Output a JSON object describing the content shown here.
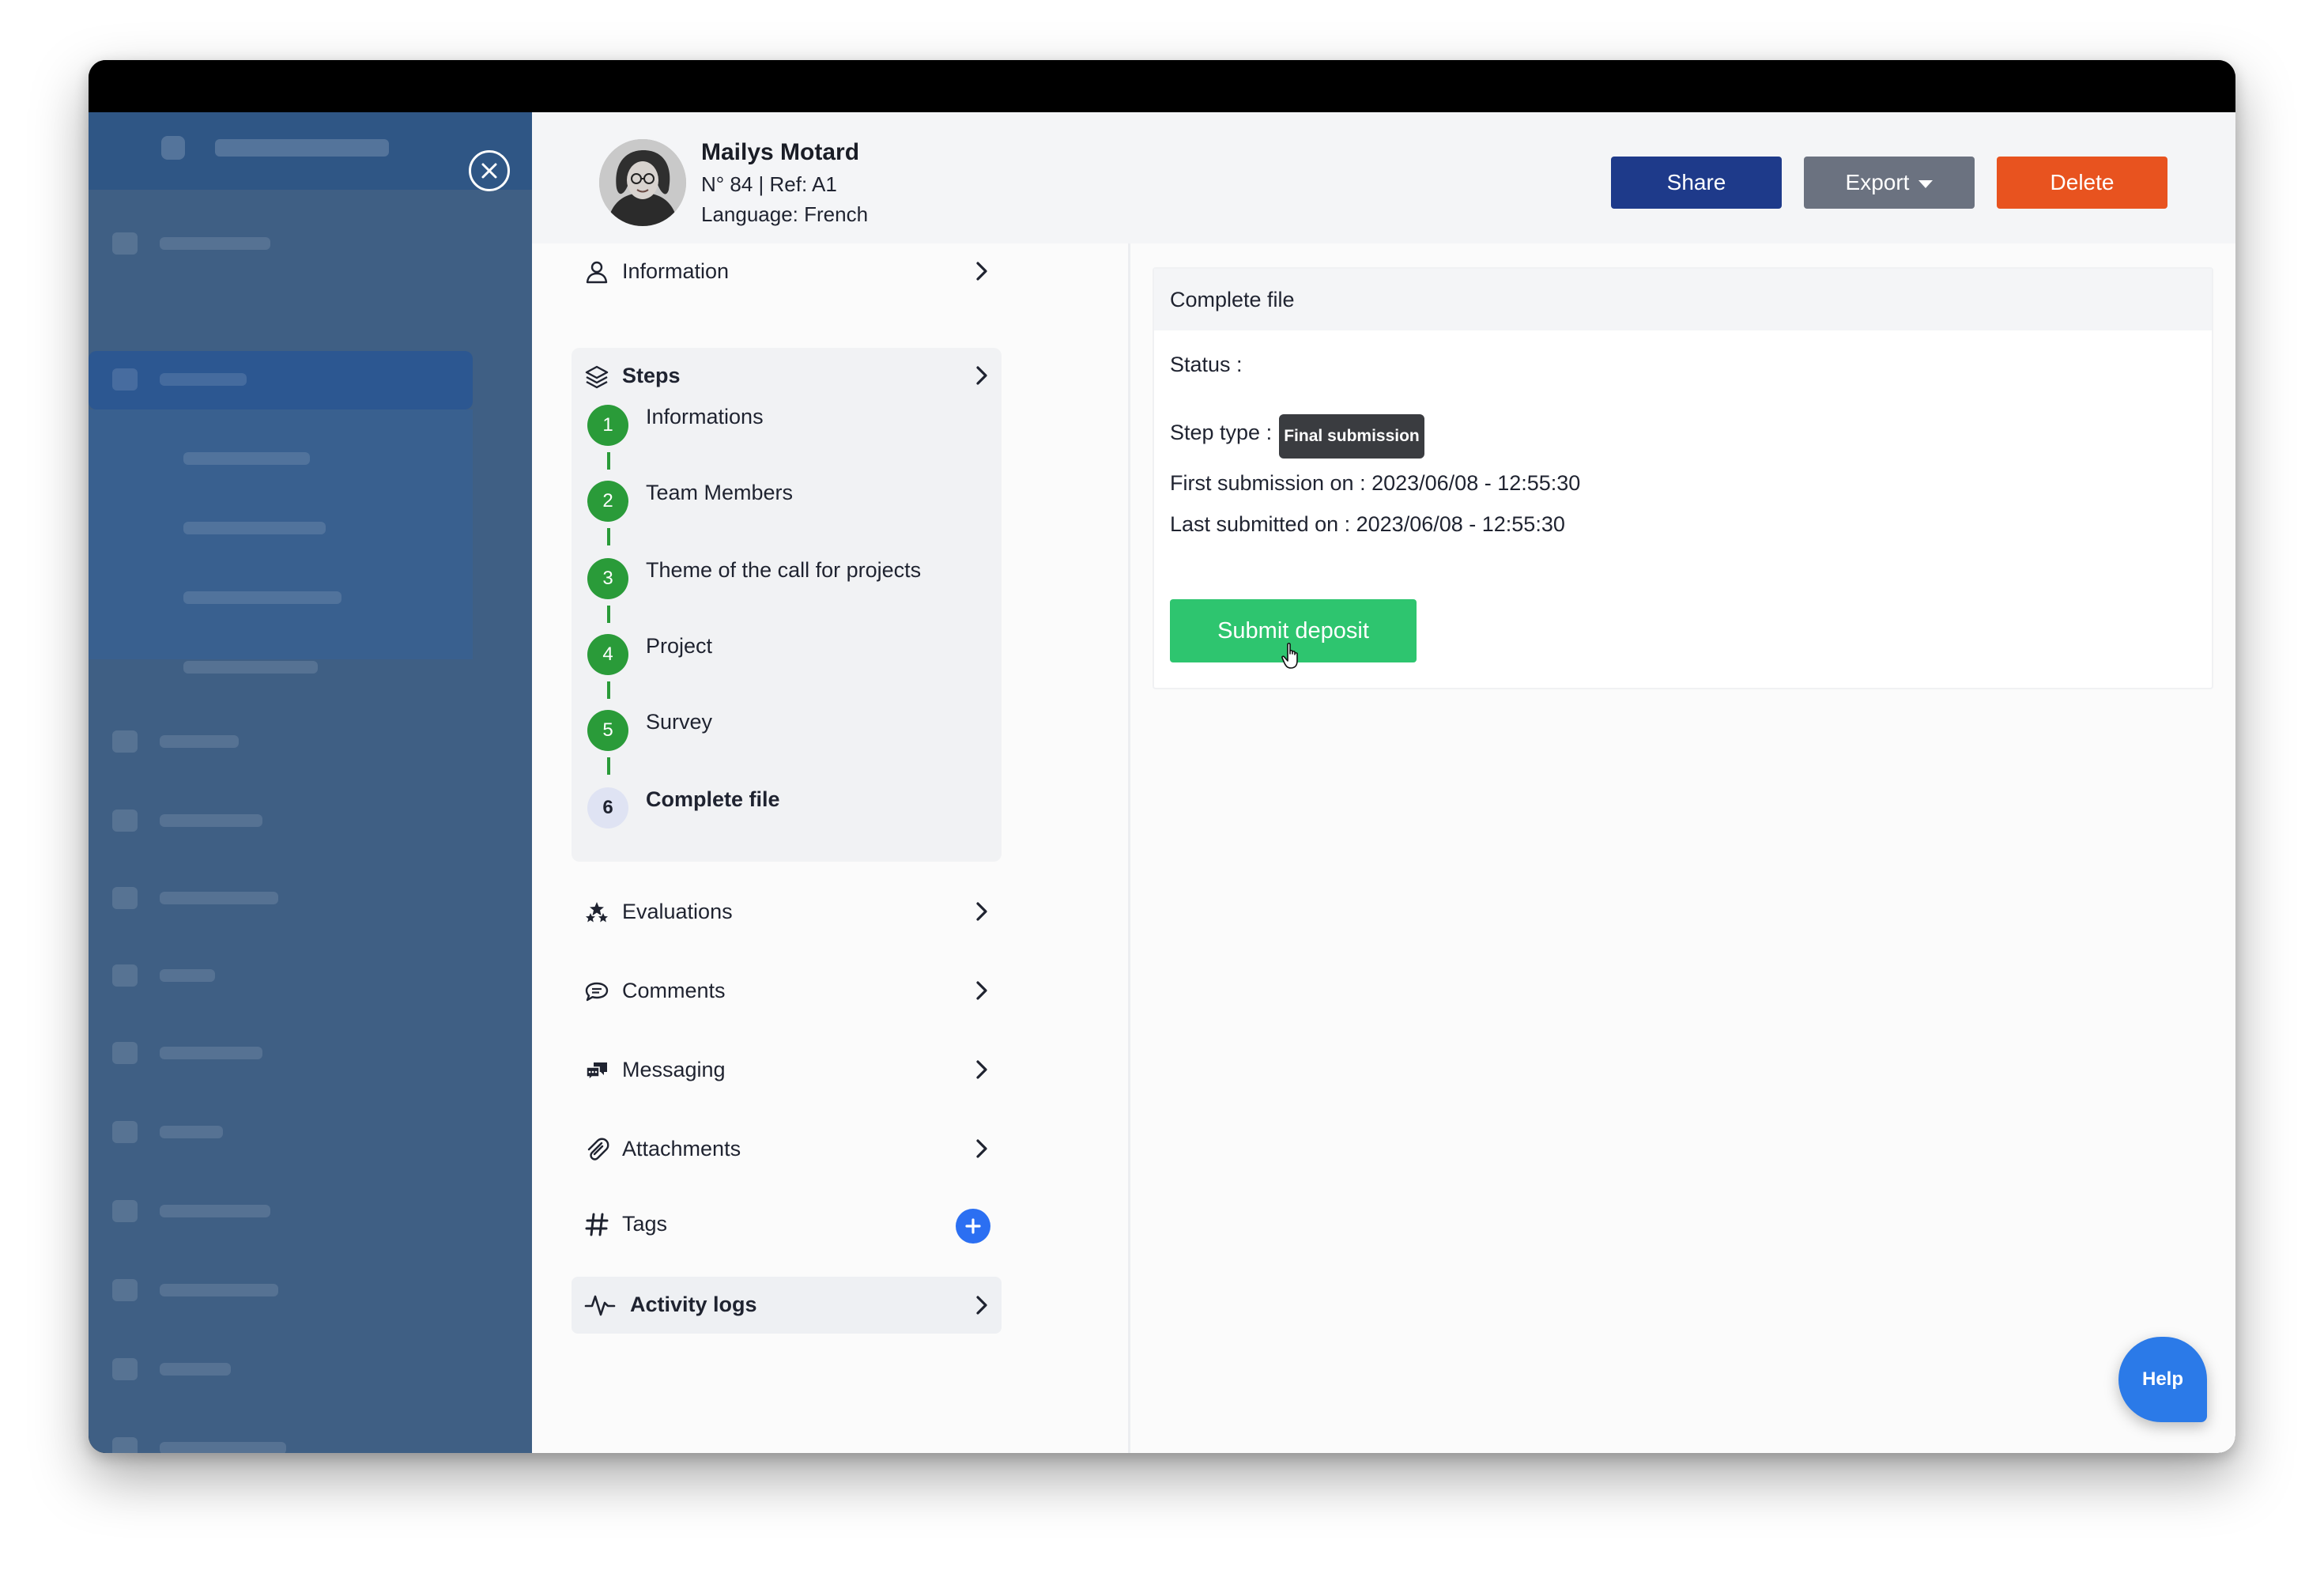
{
  "profile": {
    "name": "Mailys Motard",
    "reference": "N° 84 | Ref: A1",
    "language": "Language: French"
  },
  "actions": {
    "share": "Share",
    "export": "Export",
    "delete": "Delete"
  },
  "nav": {
    "information": "Information",
    "steps": "Steps",
    "evaluations": "Evaluations",
    "comments": "Comments",
    "messaging": "Messaging",
    "attachments": "Attachments",
    "tags": "Tags",
    "activity_logs": "Activity logs"
  },
  "steps": [
    {
      "number": "1",
      "label": "Informations",
      "state": "done"
    },
    {
      "number": "2",
      "label": "Team Members",
      "state": "done"
    },
    {
      "number": "3",
      "label": "Theme of the call for projects",
      "state": "done"
    },
    {
      "number": "4",
      "label": "Project",
      "state": "done"
    },
    {
      "number": "5",
      "label": "Survey",
      "state": "done"
    },
    {
      "number": "6",
      "label": "Complete file",
      "state": "current"
    }
  ],
  "content": {
    "title": "Complete file",
    "status": "Status :",
    "step_type_label": "Step type :",
    "step_type_badge": "Final submission",
    "first_submission": "First submission on : 2023/06/08 - 12:55:30",
    "last_submitted": "Last submitted on : 2023/06/08 - 12:55:30",
    "submit_button": "Submit deposit"
  },
  "help": "Help",
  "colors": {
    "share": "#1e3a8a",
    "export": "#6b7280",
    "delete": "#e8531f",
    "step_done": "#2a9b39",
    "submit": "#2ec56f",
    "help": "#2b7ae8"
  }
}
